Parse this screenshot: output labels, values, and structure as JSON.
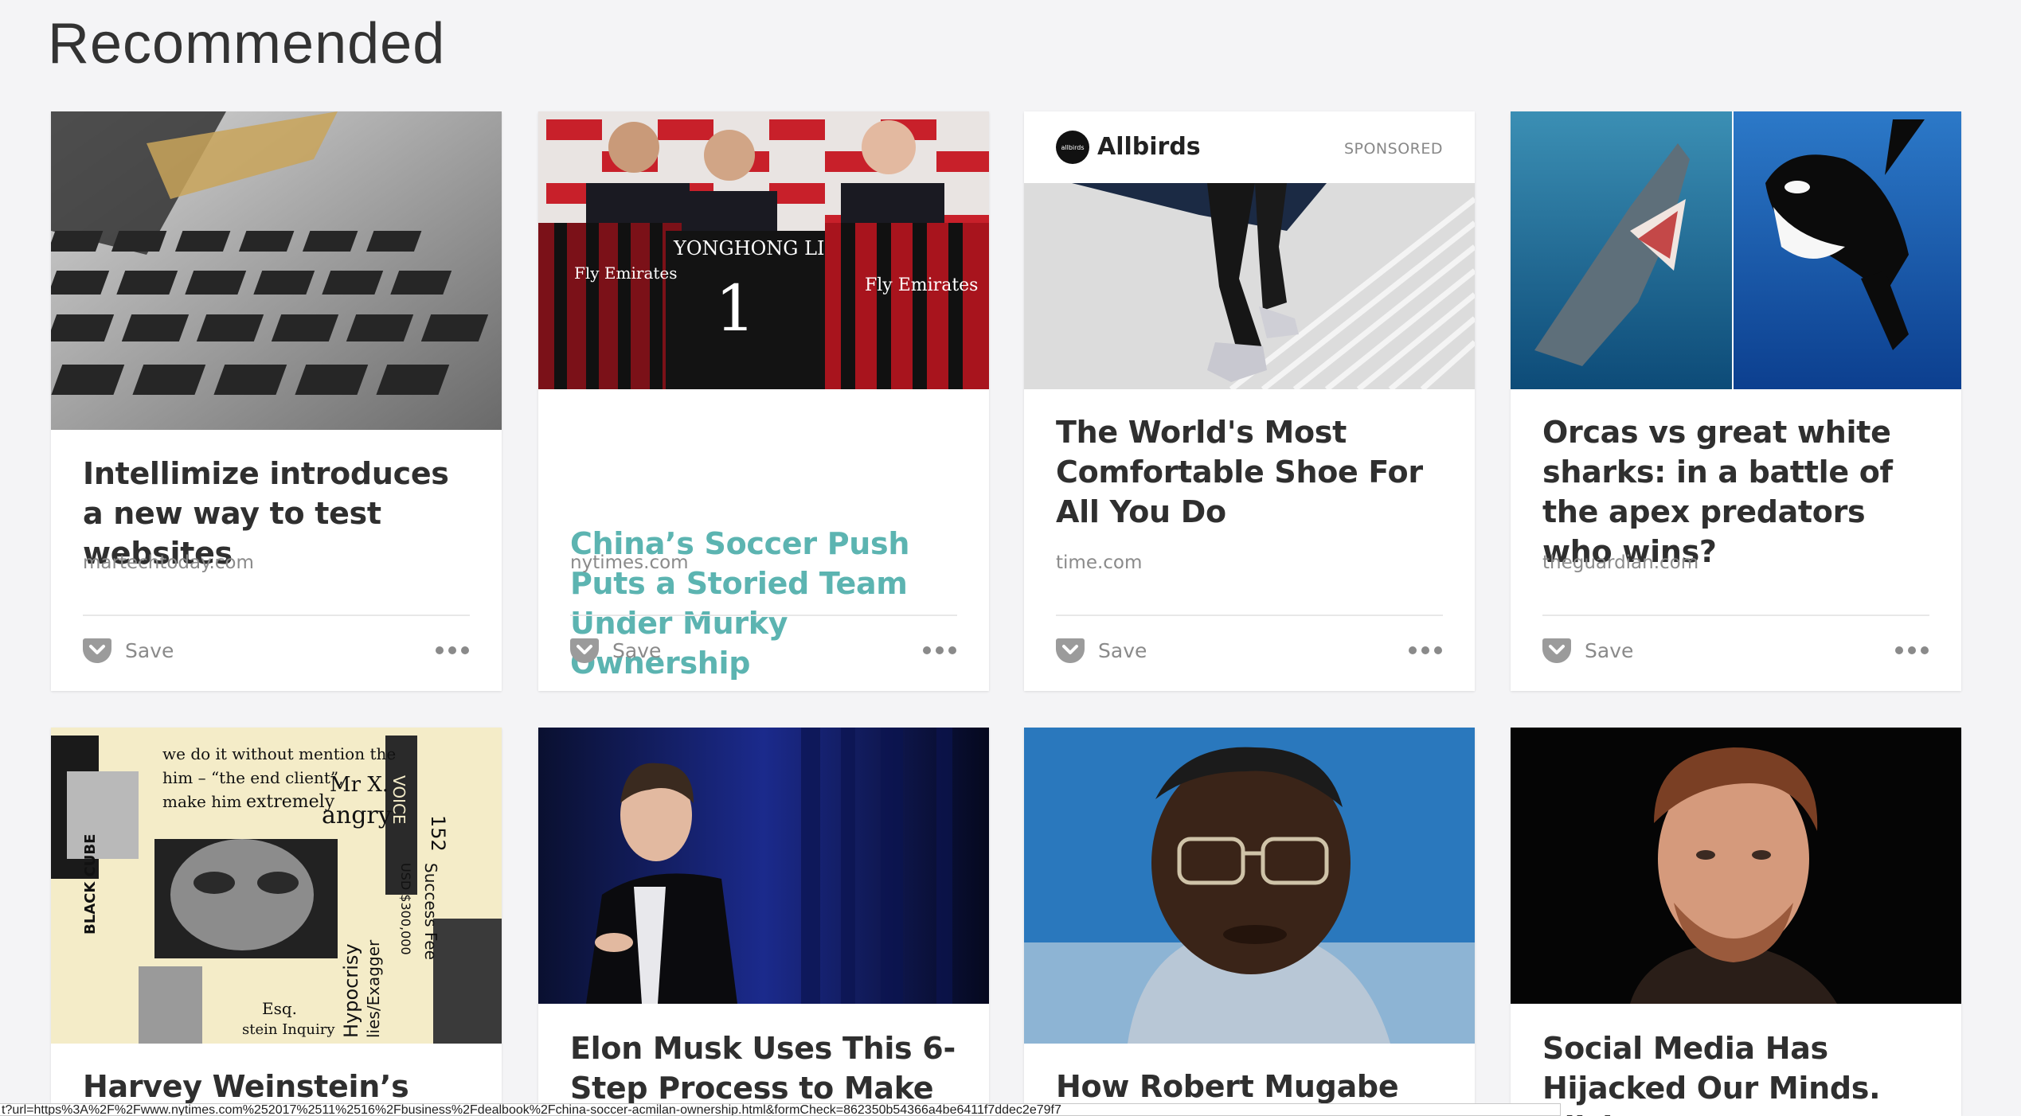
{
  "section": {
    "title": "Recommended"
  },
  "cards": [
    {
      "title": "Intellimize introduces a new way to test websites",
      "source": "martechtoday.com",
      "save_label": "Save",
      "image": "laptop keyboard with credit card"
    },
    {
      "title": "China’s Soccer Push Puts a Storied Team Under Murky Ownership",
      "source": "nytimes.com",
      "save_label": "Save",
      "image": "men holding AC Milan jerseys",
      "jersey_text": "Fly Emirates",
      "jersey_name": "YONGHONG LI",
      "jersey_number": "1"
    },
    {
      "title": "The World's Most Comfortable Shoe For All You Do",
      "source": "time.com",
      "save_label": "Save",
      "image": "person walking up stairs",
      "sponsor": {
        "logo_text": "allbirds",
        "name": "Allbirds",
        "tag": "SPONSORED"
      }
    },
    {
      "title": "Orcas vs great white sharks: in a battle of the apex predators who wins?",
      "source": "theguardian.com",
      "save_label": "Save",
      "image": "shark and orca underwater"
    },
    {
      "title": "Harvey Weinstein’s Army",
      "image": "collage of torn documents and faces",
      "collage_texts": [
        "we do it without mention the",
        "him – “the end client”,",
        "Mr X.",
        "make him",
        "extremely",
        "angry",
        "VOICE",
        "152",
        "BLACK CUBE",
        "Success Fee",
        "USD $300,000",
        "Hypocrisy",
        "lies/Exagger",
        "Esq.",
        "stein Inquiry"
      ]
    },
    {
      "title": "Elon Musk Uses This 6-Step Process to Make",
      "image": "Elon Musk speaking on stage"
    },
    {
      "title": "How Robert Mugabe held",
      "image": "portrait of Robert Mugabe"
    },
    {
      "title": "Social Media Has Hijacked Our Minds. Click",
      "image": "portrait of a man"
    }
  ],
  "status_bar": {
    "url": "t?url=https%3A%2F%2Fwww.nytimes.com%252017%2511%2516%2Fbusiness%2Fdealbook%2Fchina-soccer-acmilan-ownership.html&formCheck=862350b54366a4be6411f7ddec2e79f7"
  },
  "colors": {
    "visited_title": "#5cb4b1",
    "background": "#f4f4f6"
  },
  "icons": {
    "save": "pocket-icon",
    "more": "ellipsis-icon"
  }
}
